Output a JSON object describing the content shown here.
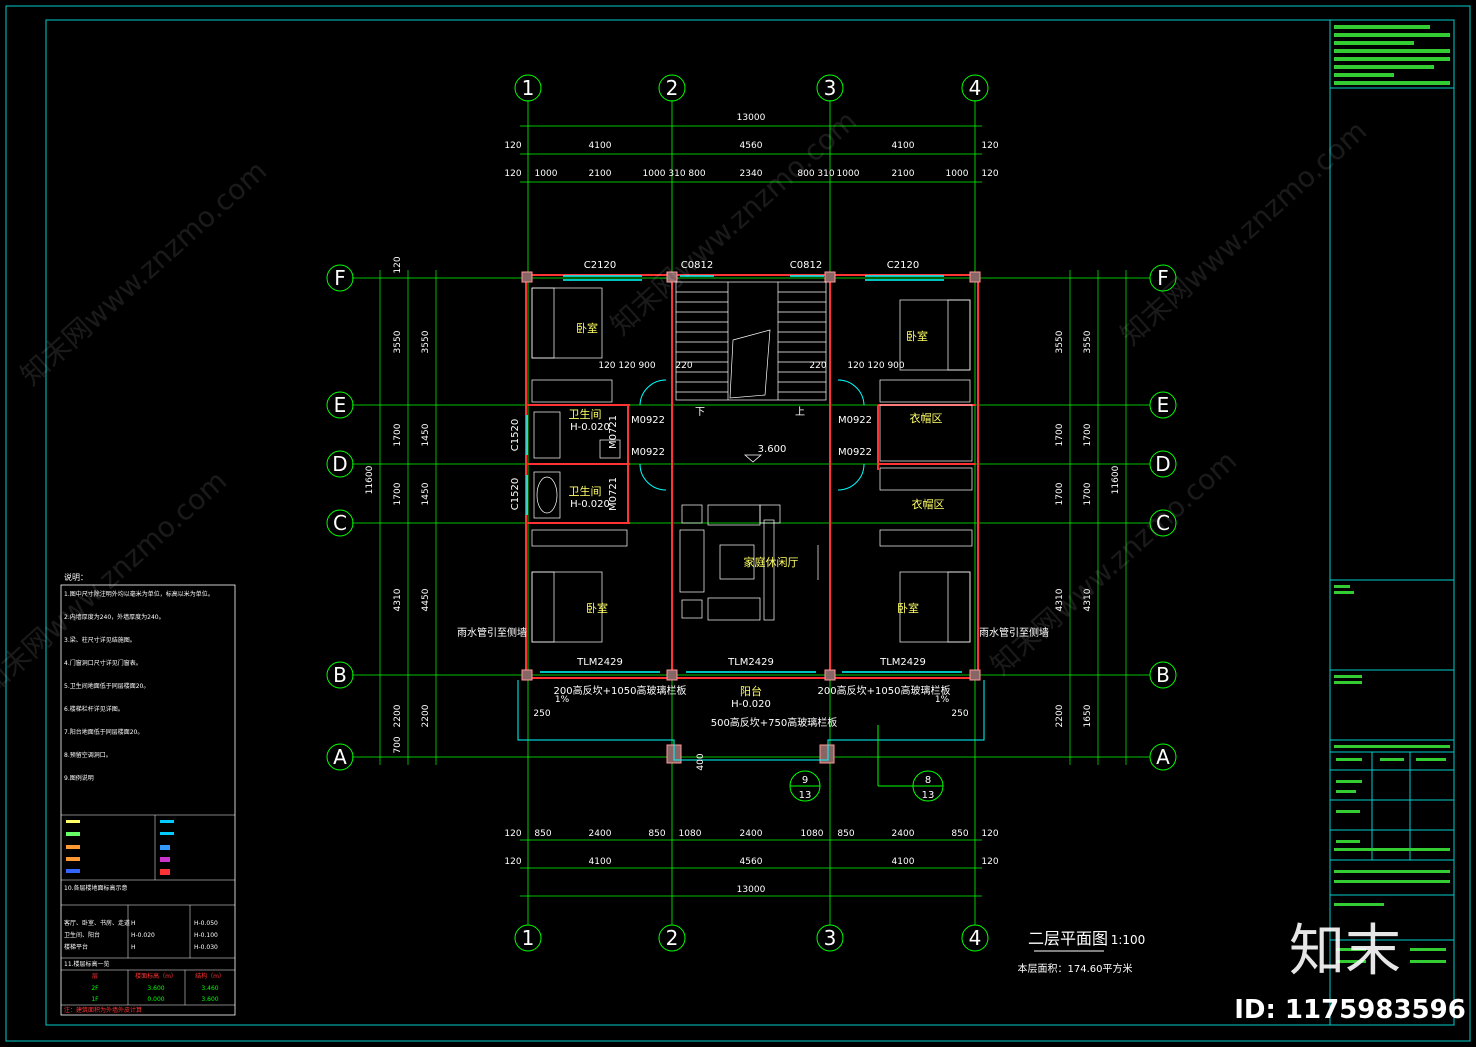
{
  "axes": {
    "top": [
      "1",
      "2",
      "3",
      "4"
    ],
    "side": [
      "F",
      "E",
      "D",
      "C",
      "B",
      "A"
    ]
  },
  "dims": {
    "overall_w": "13000",
    "row2_top": [
      "120",
      "4100",
      "4560",
      "4100",
      "120"
    ],
    "row3_top": [
      "120",
      "1000",
      "2100",
      "1000",
      "310",
      "800",
      "2340",
      "800",
      "310",
      "1000",
      "2100",
      "1000",
      "120"
    ],
    "row1_bottom": [
      "120",
      "850",
      "2400",
      "850",
      "1080",
      "2400",
      "1080",
      "850",
      "2400",
      "850",
      "120"
    ],
    "row2_bottom": [
      "120",
      "4100",
      "4560",
      "4100",
      "120"
    ],
    "overall_bottom": "13000",
    "left_outer": [
      "3550",
      "1700",
      "1700",
      "4310",
      "2200"
    ],
    "left_inner": [
      "3550",
      "1450",
      "1450",
      "4450",
      "2200"
    ],
    "left_small": [
      "120",
      "120",
      "120",
      "120",
      "120",
      "700"
    ],
    "overall_h": "11600",
    "right_outer": [
      "3550",
      "1700",
      "1700",
      "4310",
      "2200"
    ],
    "right_inner": [
      "3550",
      "1700",
      "1700",
      "4310",
      "1650"
    ]
  },
  "windows": {
    "top_c2120_l": "C2120",
    "top_c0812_l": "C0812",
    "top_c0812_r": "C0812",
    "top_c2120_r": "C2120",
    "c1520_a": "C1520",
    "c1520_b": "C1520",
    "tlm_l": "TLM2429",
    "tlm_c": "TLM2429",
    "tlm_r": "TLM2429"
  },
  "doors": {
    "m0922_a": "M0922",
    "m0922_b": "M0922",
    "m0922_c": "M0922",
    "m0922_d": "M0922",
    "m0721_a": "M0721",
    "m0721_b": "M0721"
  },
  "rooms": {
    "bedroom_tl": "卧室",
    "bedroom_tr": "卧室",
    "bedroom_bl": "卧室",
    "bedroom_br": "卧室",
    "bath_1": "卫生间",
    "bath_2": "卫生间",
    "bath_h1": "H-0.020",
    "bath_h2": "H-0.020",
    "closet_1": "衣帽区",
    "closet_2": "衣帽区",
    "family_hall": "家庭休闲厅",
    "balcony": "阳台",
    "balcony_h": "H-0.020",
    "level": "3.600",
    "stair_down": "下",
    "stair_up": "上"
  },
  "labels": {
    "rail_l": "200高反坎+1050高玻璃栏板",
    "rail_r": "200高反坎+1050高玻璃栏板",
    "rail_c": "500高反坎+750高玻璃栏板",
    "drain_l": "雨水管引至侧墙",
    "drain_r": "雨水管引至侧墙",
    "ref1_top": "9",
    "ref1_bottom": "13",
    "ref2_top": "8",
    "ref2_bottom": "13",
    "slope": "1%",
    "d_250": "250",
    "d_400": "400",
    "d_120_900": "120 120 900",
    "d_220": "220"
  },
  "title": {
    "name": "二层平面图",
    "scale": "1:100",
    "area": "本层面积：174.60平方米"
  },
  "notes": {
    "heading": "说明：",
    "lines": [
      "1.图中尺寸除注明外均以毫米为单位，标高以米为单位。",
      "2.内墙厚度为240，外墙厚度为240。",
      "3.梁、柱尺寸详见结施图。",
      "4.门窗洞口尺寸详见门窗表。",
      "5.卫生间地面低于同层楼面20。",
      "6.楼梯栏杆详见详图。",
      "7.阳台地面低于同层楼面20。",
      "8.预留空调洞口。",
      "9.图例说明"
    ],
    "table_heading": "10.各层楼地面标高示意",
    "rows": [
      [
        "客厅、卧室、书房、走道",
        "H",
        "H-0.050"
      ],
      [
        "卫生间、阳台",
        "H-0.020",
        "H-0.100"
      ],
      [
        "楼梯平台",
        "H",
        "H-0.030"
      ]
    ],
    "level_heading": "11.楼层标高一览",
    "level_cols": [
      "层",
      "楼面标高（m）",
      "结构（m）"
    ],
    "levels": [
      [
        "2F",
        "3.600",
        "3.460"
      ],
      [
        "1F",
        "0.000",
        "3.600"
      ]
    ],
    "footer": "注：建筑面积为外墙外皮计算"
  },
  "brand": {
    "logo": "知末",
    "id": "ID: 1175983596",
    "watermark": "知末网www.znzmo.com"
  },
  "colors": {
    "axis": "#00ff00",
    "wall": "#ff3333",
    "glass": "#00ffff",
    "dim": "#ffffff",
    "room": "#ffff66",
    "frame": "#00cccc",
    "titlebar": "#33cc33"
  }
}
